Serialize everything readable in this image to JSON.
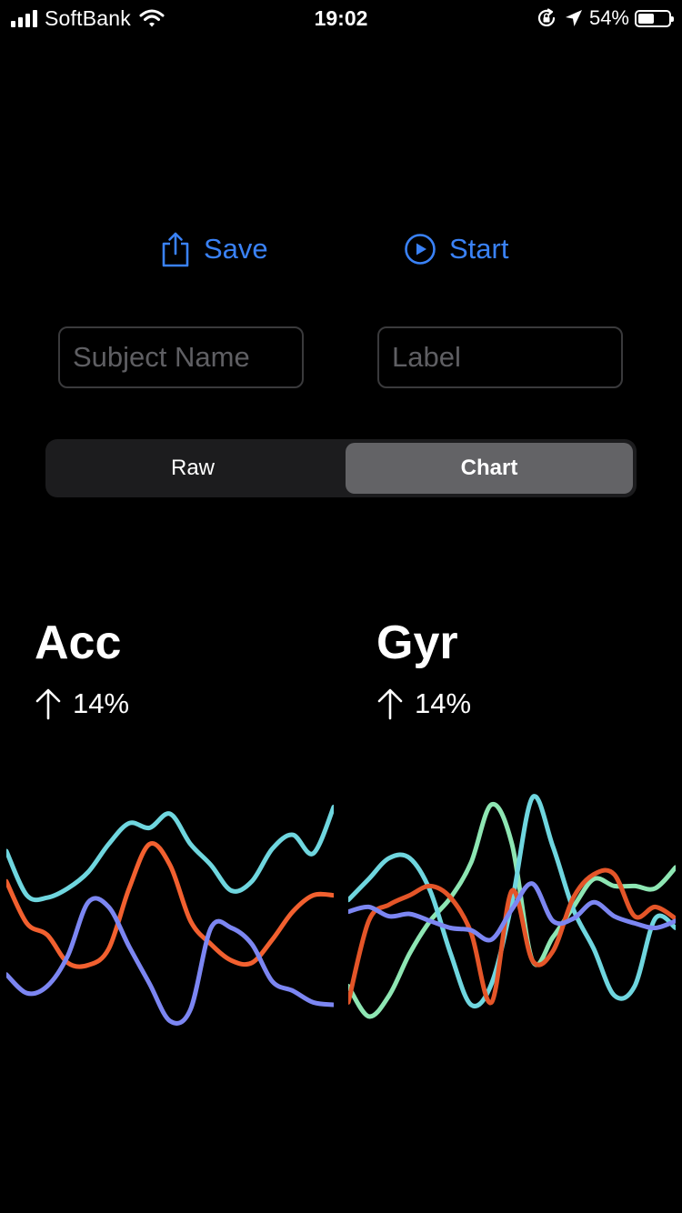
{
  "status_bar": {
    "carrier": "SoftBank",
    "time": "19:02",
    "battery": "54%",
    "battery_level": 0.54,
    "icons": [
      "signal-icon",
      "wifi-icon",
      "orientation-lock-icon",
      "location-icon",
      "battery-icon"
    ]
  },
  "actions": {
    "save_label": "Save",
    "save_icon": "share-icon",
    "start_label": "Start",
    "start_icon": "play-circle-icon",
    "accent": "#3a82f7"
  },
  "fields": {
    "subject_placeholder": "Subject Name",
    "label_placeholder": "Label",
    "subject_value": "",
    "label_value": ""
  },
  "segmented": {
    "options": [
      "Raw",
      "Chart"
    ],
    "selected": "Chart"
  },
  "metrics": {
    "acc": {
      "title": "Acc",
      "change": "14%",
      "direction": "up",
      "icon": "arrow-up-icon"
    },
    "gyr": {
      "title": "Gyr",
      "change": "14%",
      "direction": "up",
      "icon": "arrow-up-icon"
    }
  },
  "chart_data": [
    {
      "type": "line",
      "name": "acc",
      "ylim": [
        0,
        1
      ],
      "grid": false,
      "series": [
        {
          "color": "#6fd6df",
          "values": [
            0.75,
            0.56,
            0.55,
            0.59,
            0.66,
            0.78,
            0.87,
            0.85,
            0.91,
            0.78,
            0.69,
            0.58,
            0.62,
            0.76,
            0.82,
            0.74,
            0.94
          ]
        },
        {
          "color": "#f2602f",
          "values": [
            0.62,
            0.44,
            0.39,
            0.27,
            0.26,
            0.33,
            0.59,
            0.78,
            0.69,
            0.45,
            0.35,
            0.28,
            0.27,
            0.37,
            0.49,
            0.56,
            0.56
          ]
        },
        {
          "color": "#7c86f2",
          "values": [
            0.22,
            0.14,
            0.17,
            0.3,
            0.53,
            0.51,
            0.34,
            0.18,
            0.02,
            0.07,
            0.42,
            0.42,
            0.35,
            0.19,
            0.15,
            0.1,
            0.09
          ]
        }
      ]
    },
    {
      "type": "line",
      "name": "gyr",
      "ylim": [
        0,
        1
      ],
      "grid": false,
      "series": [
        {
          "color": "#8ee6b3",
          "values": [
            0.17,
            0.04,
            0.13,
            0.31,
            0.45,
            0.55,
            0.7,
            0.95,
            0.78,
            0.28,
            0.38,
            0.51,
            0.63,
            0.6,
            0.6,
            0.59,
            0.68
          ]
        },
        {
          "color": "#6fd6df",
          "values": [
            0.54,
            0.63,
            0.72,
            0.72,
            0.58,
            0.31,
            0.09,
            0.18,
            0.53,
            0.98,
            0.77,
            0.5,
            0.33,
            0.13,
            0.17,
            0.46,
            0.42
          ]
        },
        {
          "color": "#e45528",
          "values": [
            0.1,
            0.45,
            0.52,
            0.56,
            0.6,
            0.55,
            0.4,
            0.1,
            0.58,
            0.28,
            0.32,
            0.55,
            0.65,
            0.65,
            0.47,
            0.51,
            0.46
          ]
        },
        {
          "color": "#7c86f2",
          "values": [
            0.49,
            0.51,
            0.47,
            0.48,
            0.45,
            0.42,
            0.41,
            0.37,
            0.5,
            0.61,
            0.45,
            0.46,
            0.53,
            0.47,
            0.44,
            0.42,
            0.45
          ]
        }
      ]
    }
  ]
}
